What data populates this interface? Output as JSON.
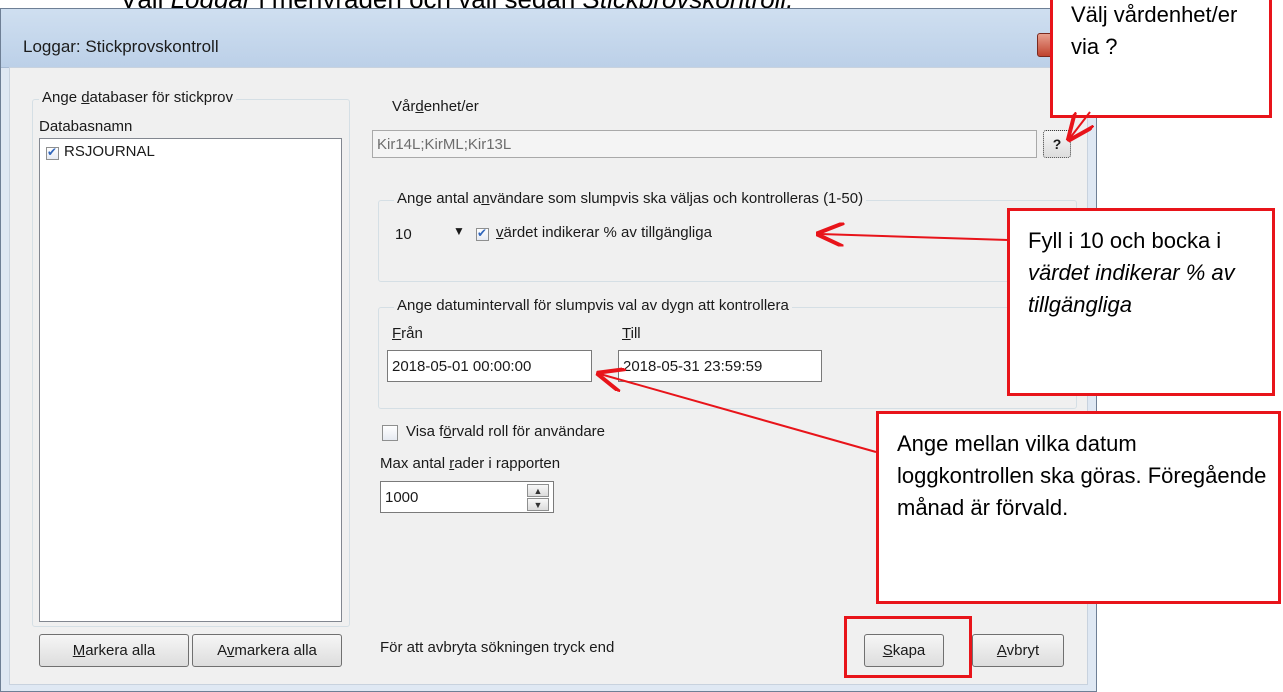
{
  "doc_caption": {
    "prefix": "Välj ",
    "menu": "Loggar",
    "middle": " i menyraden och välj sedan ",
    "item": "Stickprovskontroll."
  },
  "window": {
    "title": "Loggar: Stickprovskontroll"
  },
  "databases": {
    "group_title": "Ange databaser för stickprov",
    "column_header": "Databasnamn",
    "items": [
      {
        "name": "RSJOURNAL",
        "checked": true
      }
    ],
    "select_all_label": "Markera alla",
    "deselect_all_label": "Avmarkera alla"
  },
  "care_units": {
    "label": "Vårdenhet/er",
    "value": "Kir14L;KirML;Kir13L",
    "browse_label": "?"
  },
  "user_count": {
    "group_title": "Ange antal användare som slumpvis ska väljas och kontrolleras (1-50)",
    "value": "10",
    "percent_checked": true,
    "percent_label": "värdet indikerar % av tillgängliga"
  },
  "date_range": {
    "group_title": "Ange datumintervall för slumpvis val av dygn att kontrollera",
    "from_label": "Från",
    "from_value": "2018-05-01 00:00:00",
    "to_label": "Till",
    "to_value": "2018-05-31 23:59:59"
  },
  "default_role": {
    "checked": false,
    "label": "Visa förvald roll för användare"
  },
  "max_rows": {
    "label": "Max antal rader i rapporten",
    "value": "1000"
  },
  "footer": {
    "hint": "För att avbryta sökningen tryck end",
    "create_label": "Skapa",
    "cancel_label": "Avbryt"
  },
  "callouts": {
    "care_unit": "Välj vårdenhet/er via ?",
    "count_line1": "Fyll i 10 och bocka i ",
    "count_emph": "värdet indikerar % av tillgängliga",
    "dates": "Ange mellan vilka datum loggkontrollen ska göras. Föregående månad är förvald."
  },
  "colors": {
    "annotation": "#e8141a",
    "window_frame": "#dfe8f3",
    "client": "#f0f0f0"
  }
}
